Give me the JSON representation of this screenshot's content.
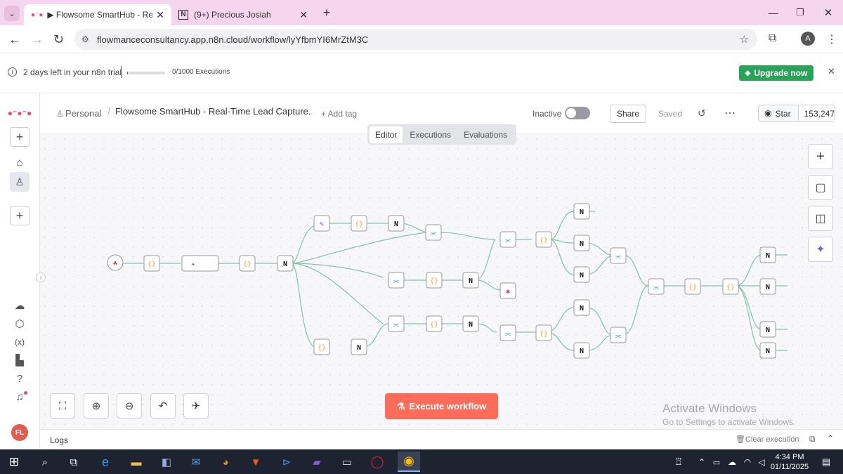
{
  "browser": {
    "tabs": [
      {
        "label": "▶ Flowsome SmartHub - Real-T",
        "active": true
      },
      {
        "label": "(9+) Precious Josiah",
        "active": false
      }
    ],
    "url": "flowmanceconsultancy.app.n8n.cloud/workflow/lyYfbmYI6MrZtM3C",
    "profile_initial": "A"
  },
  "trial": {
    "text": "2 days left in your n8n trial",
    "executions": "0/1000 Executions",
    "progress": 0.02,
    "upgrade_label": "Upgrade now"
  },
  "header": {
    "breadcrumb": "Personal",
    "title": "Flowsome SmartHub - Real-Time Lead Capture.",
    "add_tag": "+ Add tag",
    "inactive_label": "Inactive",
    "share_label": "Share",
    "saved_label": "Saved",
    "star_label": "Star",
    "star_count": "153,247"
  },
  "tabs": {
    "editor": "Editor",
    "executions": "Executions",
    "evaluations": "Evaluations"
  },
  "sidebar": {
    "avatar": "FL"
  },
  "canvas": {
    "execute_label": "Execute workflow",
    "watermark_title": "Activate Windows",
    "watermark_sub": "Go to Settings to activate Windows."
  },
  "logs": {
    "label": "Logs",
    "clear_label": "Clear execution"
  },
  "taskbar": {
    "time": "4:34 PM",
    "date": "01/11/2025"
  },
  "colors": {
    "accent": "#ea4b71",
    "execute": "#ff6d5a",
    "upgrade": "#29a35a",
    "edge": "#7fc4a8"
  }
}
